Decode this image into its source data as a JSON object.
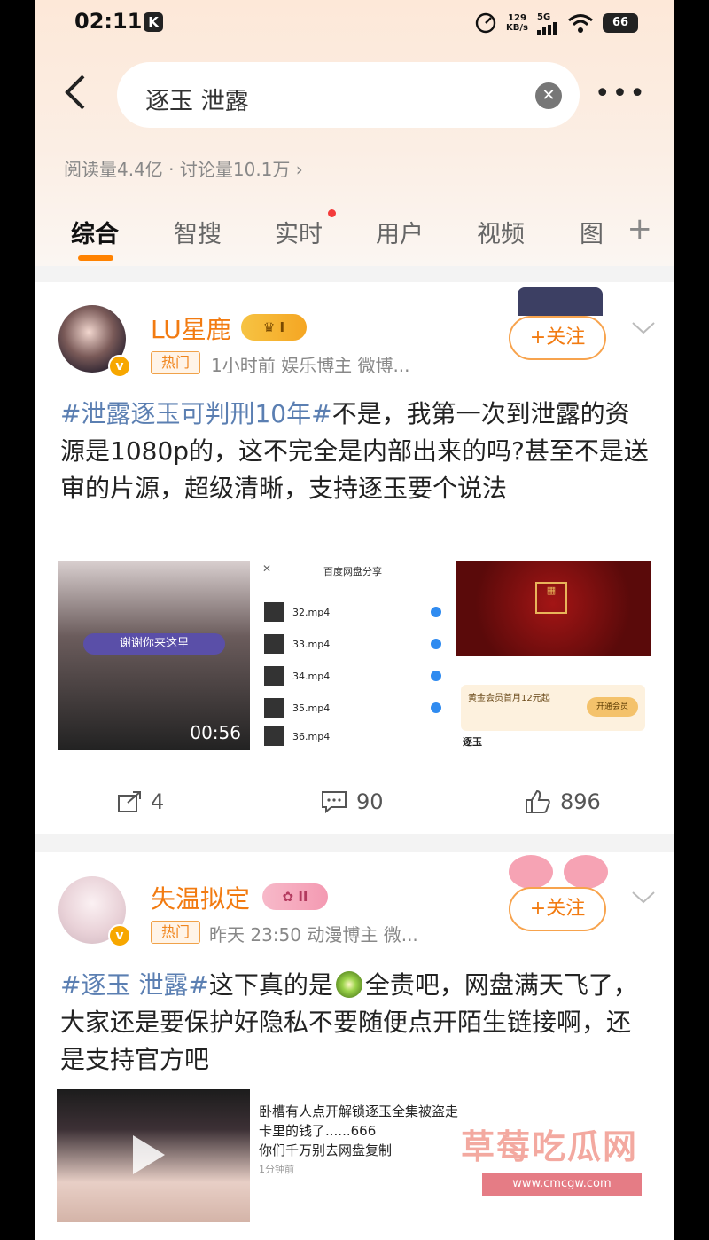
{
  "status": {
    "time": "02:11",
    "k_badge": "K",
    "speed_top": "129",
    "speed_unit": "KB/s",
    "network": "5G",
    "battery": "66"
  },
  "search": {
    "query": "逐玉 泄露",
    "more": "•••"
  },
  "stats": "阅读量4.4亿 · 讨论量10.1万 ›",
  "tabs": [
    "综合",
    "智搜",
    "实时",
    "用户",
    "视频",
    "图"
  ],
  "posts": [
    {
      "username": "LU星鹿",
      "level": "I",
      "hot": "热门",
      "meta": "1小时前  娱乐博主 微博...",
      "follow": "+关注",
      "hashtag": "#泄露逐玉可判刑10年#",
      "text": "不是，我第一次到泄露的资源是1080p的，这不完全是内部出来的吗?甚至不是送审的片源，超级清晰，支持逐玉要个说法",
      "video_duration": "00:56",
      "video_caption": "谢谢你来这里",
      "share_title": "百度网盘分享",
      "share_files": [
        "32.mp4",
        "33.mp4",
        "34.mp4",
        "35.mp4",
        "36.mp4"
      ],
      "iqiyi_show": "逐玉",
      "iqiyi_promo": "黄金会员首月12元起",
      "iqiyi_btn": "开通会员",
      "reposts": "4",
      "comments": "90",
      "likes": "896"
    },
    {
      "username": "失温拟定",
      "level": "II",
      "hot": "热门",
      "meta": "昨天 23:50  动漫博主 微...",
      "follow": "+关注",
      "hashtag": "#逐玉 泄露#",
      "text_a": "这下真的是",
      "text_b": "全责吧，网盘满天飞了，大家还是要保护好隐私不要随便点开陌生链接啊，还是支持官方吧",
      "quote_line1": "卧槽有人点开解锁逐玉全集被盗走",
      "quote_line2": "卡里的钱了......666",
      "quote_line3": "你们千万别去网盘复制",
      "quote_time": "1分钟前"
    }
  ],
  "watermark": {
    "title": "草莓吃瓜网",
    "url": "www.cmcgw.com"
  }
}
